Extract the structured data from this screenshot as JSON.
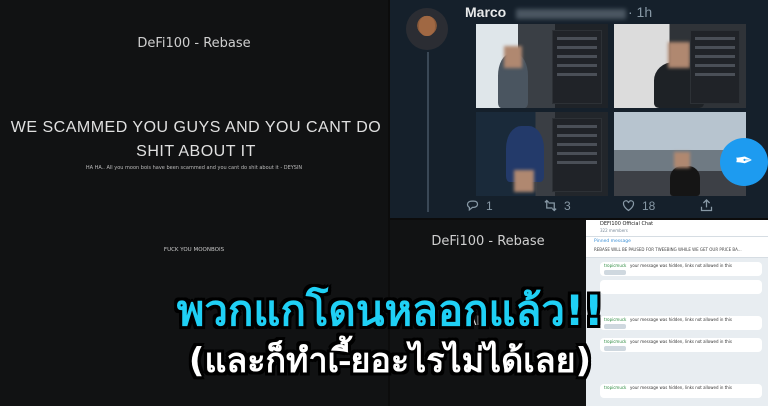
{
  "left_site": {
    "title": "DeFi100 - Rebase",
    "headline": "WE SCAMMED YOU GUYS AND YOU CANT DO SHIT ABOUT IT",
    "subline": "HA HA.. All you moon bois have been scammed and you cant do shit about it - DEYSIN",
    "footer": "FUCK YOU MOONBOIS"
  },
  "tweet": {
    "name": "Marco",
    "time": "· 1h",
    "replies": "1",
    "retweets": "3",
    "likes": "18"
  },
  "right_site": {
    "title": "DeFi100 - Rebase",
    "headline_fragment": "SH  ABOUT IT"
  },
  "telegram": {
    "title": "DEFI100 Official Chat",
    "members": "322 members",
    "pinned_label": "Pinned message",
    "pinned_text": "REBASE WILL BE PAUSED FOR TWEEBING WHILE WE GET OUR PRICE BA...",
    "messages": [
      {
        "sender": "tropicmuck",
        "text": "your message was hidden, links not allowed in this"
      },
      {
        "sender": "",
        "text": ""
      },
      {
        "sender": "tropicmuck",
        "text": "your message was hidden, links not allowed in this"
      },
      {
        "sender": "tropicmuck",
        "text": "your message was hidden, links not allowed in this"
      },
      {
        "sender": "tropicmuck",
        "text": "your message was hidden, links not allowed in this"
      }
    ]
  },
  "caption": {
    "line1": "พวกแกโดนหลอกแล้ว!!",
    "line2": "(และก็ทำเ-ี้ยอะไรไม่ได้เลย)"
  },
  "colors": {
    "caption_accent": "#1fd0f5",
    "twitter_bg": "#15202b",
    "twitter_blue": "#1d9bf0"
  },
  "icons": [
    "reply-icon",
    "retweet-icon",
    "like-icon",
    "share-icon",
    "compose-feather-icon"
  ]
}
